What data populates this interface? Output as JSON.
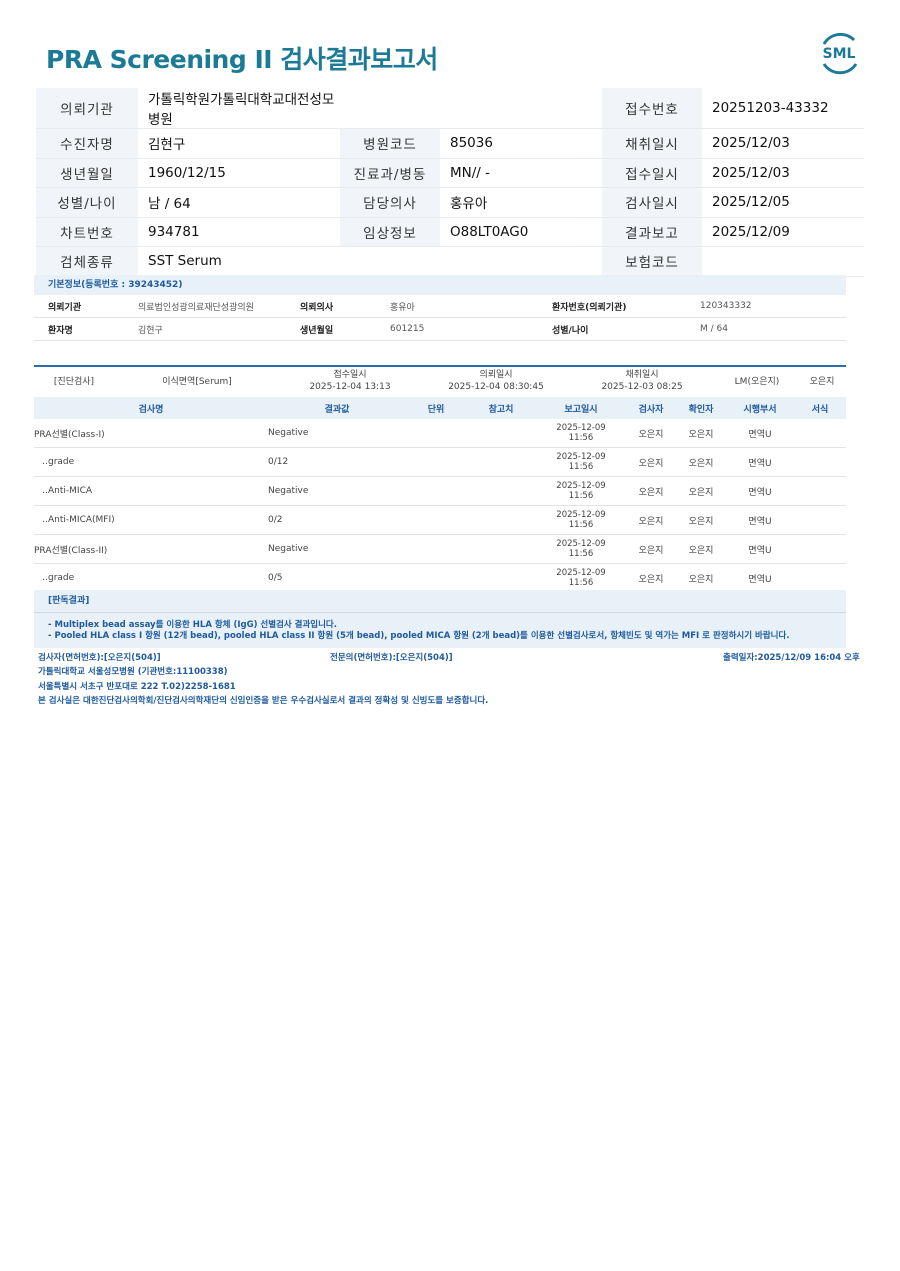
{
  "title": "PRA Screening II 검사결과보고서",
  "logo_text": "SML",
  "header": {
    "rows": [
      [
        {
          "label": "의뢰기관",
          "value": "가톨릭학원가톨릭대학교대전성모병원"
        },
        {
          "label": "",
          "value": ""
        },
        {
          "label": "접수번호",
          "value": "20251203-43332"
        }
      ],
      [
        {
          "label": "수진자명",
          "value": "김현구"
        },
        {
          "label": "병원코드",
          "value": "85036"
        },
        {
          "label": "채취일시",
          "value": "2025/12/03"
        }
      ],
      [
        {
          "label": "생년월일",
          "value": "1960/12/15"
        },
        {
          "label": "진료과/병동",
          "value": "MN// -"
        },
        {
          "label": "접수일시",
          "value": "2025/12/03"
        }
      ],
      [
        {
          "label": "성별/나이",
          "value": "남 / 64"
        },
        {
          "label": "담당의사",
          "value": "홍유아"
        },
        {
          "label": "검사일시",
          "value": "2025/12/05"
        }
      ],
      [
        {
          "label": "차트번호",
          "value": "934781"
        },
        {
          "label": "임상정보",
          "value": "O88LT0AG0"
        },
        {
          "label": "결과보고",
          "value": "2025/12/09"
        }
      ],
      [
        {
          "label": "검체종류",
          "value": "SST Serum"
        },
        {
          "label": "",
          "value": ""
        },
        {
          "label": "보험코드",
          "value": ""
        }
      ]
    ]
  },
  "basic": {
    "header": "기본정보(등록번호 : 39243452)",
    "row1": {
      "k1": "의뢰기관",
      "v1": "의료법인성광의료재단성광의원",
      "k2": "의뢰의사",
      "v2": "홍유아",
      "k3": "환자번호(의뢰기관)",
      "v3": "120343332"
    },
    "row2": {
      "k1": "환자명",
      "v1": "김현구",
      "k2": "생년월일",
      "v2": "601215",
      "k3": "성별/나이",
      "v3": "M / 64"
    }
  },
  "order": {
    "category": "[진단검사]",
    "dept": "이식면역[Serum]",
    "recv_label": "접수일시",
    "recv_time": "2025-12-04 13:13",
    "req_label": "의뢰일시",
    "req_time": "2025-12-04 08:30:45",
    "col_label": "채취일시",
    "col_time": "2025-12-03 08:25",
    "lm": "LM(오은지)",
    "person": "오은지"
  },
  "results": {
    "columns": [
      "검사명",
      "결과값",
      "단위",
      "참고치",
      "보고일시",
      "검사자",
      "확인자",
      "시행부서",
      "서식"
    ],
    "rows": [
      {
        "name": "PRA선별(Class-I)",
        "value": "Negative",
        "unit": "",
        "ref": "",
        "date": "2025-12-09",
        "time": "11:56",
        "tester": "오은지",
        "checker": "오은지",
        "dept": "면역U",
        "form": ""
      },
      {
        "name": "‥grade",
        "value": "0/12",
        "unit": "",
        "ref": "",
        "date": "2025-12-09",
        "time": "11:56",
        "tester": "오은지",
        "checker": "오은지",
        "dept": "면역U",
        "form": ""
      },
      {
        "name": "‥Anti-MICA",
        "value": "Negative",
        "unit": "",
        "ref": "",
        "date": "2025-12-09",
        "time": "11:56",
        "tester": "오은지",
        "checker": "오은지",
        "dept": "면역U",
        "form": ""
      },
      {
        "name": "‥Anti-MICA(MFI)",
        "value": "0/2",
        "unit": "",
        "ref": "",
        "date": "2025-12-09",
        "time": "11:56",
        "tester": "오은지",
        "checker": "오은지",
        "dept": "면역U",
        "form": ""
      },
      {
        "name": "PRA선별(Class-II)",
        "value": "Negative",
        "unit": "",
        "ref": "",
        "date": "2025-12-09",
        "time": "11:56",
        "tester": "오은지",
        "checker": "오은지",
        "dept": "면역U",
        "form": ""
      },
      {
        "name": "‥grade",
        "value": "0/5",
        "unit": "",
        "ref": "",
        "date": "2025-12-09",
        "time": "11:56",
        "tester": "오은지",
        "checker": "오은지",
        "dept": "면역U",
        "form": ""
      }
    ]
  },
  "judge": {
    "header": "[판독결과]",
    "line1": "- Multiplex bead assay를 이용한 HLA 항체 (IgG) 선별검사 결과입니다.",
    "line2": "- Pooled HLA class I 항원 (12개 bead), pooled HLA class II 항원 (5개 bead), pooled MICA 항원 (2개 bead)를 이용한 선별검사로서, 항체빈도 및 역가는 MFI 로 판정하시기 바랍니다."
  },
  "footer": {
    "tester": "검사자(면허번호):[오은지(504)]",
    "expert": "전문의(면허번호):[오은지(504)]",
    "printed": "출력일자:2025/12/09 16:04 오후",
    "org": "가톨릭대학교 서울성모병원 (기관번호:11100338)",
    "address": "서울특별시 서초구 반포대로 222 T.02)2258-1681",
    "cert": "본 검사실은 대한진단검사의학회/진단검사의학재단의 신임인증을 받은 우수검사실로서 결과의 정확성 및 신빙도를 보증합니다."
  }
}
